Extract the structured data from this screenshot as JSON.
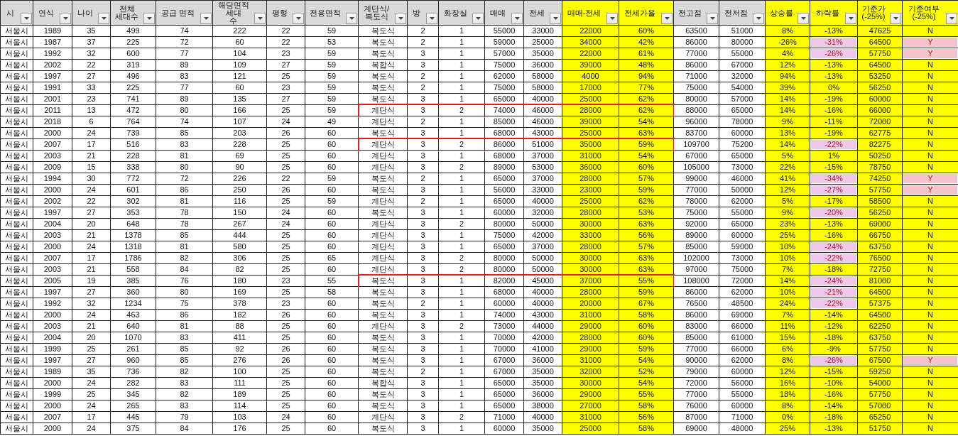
{
  "columns": [
    {
      "label": "시",
      "highlight": false
    },
    {
      "label": "연식",
      "highlight": false
    },
    {
      "label": "나이",
      "highlight": false
    },
    {
      "label": "전체\n세대수",
      "highlight": false
    },
    {
      "label": "공급 면적",
      "highlight": false
    },
    {
      "label": "해당면적 세대\n수",
      "highlight": false
    },
    {
      "label": "평형",
      "highlight": false
    },
    {
      "label": "전용면적",
      "highlight": false
    },
    {
      "label": "계단식/\n복도식",
      "highlight": false
    },
    {
      "label": "방",
      "highlight": false
    },
    {
      "label": "화장실",
      "highlight": false
    },
    {
      "label": "매매",
      "highlight": false
    },
    {
      "label": "전세",
      "highlight": false
    },
    {
      "label": "매매-전세",
      "highlight": true
    },
    {
      "label": "전세가율",
      "highlight": true
    },
    {
      "label": "전고점",
      "highlight": false
    },
    {
      "label": "전저점",
      "highlight": false
    },
    {
      "label": "상승률",
      "highlight": true
    },
    {
      "label": "하락률",
      "highlight": true
    },
    {
      "label": "기준가\n(-25%)",
      "highlight": true
    },
    {
      "label": "기준여부\n(-25%)",
      "highlight": true
    }
  ],
  "rows": [
    {
      "cells": [
        "서울시",
        "1989",
        "35",
        "499",
        "74",
        "222",
        "22",
        "59",
        "복도식",
        "2",
        "1",
        "55000",
        "33000",
        "22000",
        "60%",
        "63500",
        "51000",
        "8%",
        "-13%",
        "47625",
        "N"
      ],
      "fall_alert": false,
      "flag_alert": false,
      "outlined": false
    },
    {
      "cells": [
        "서울시",
        "1987",
        "37",
        "225",
        "72",
        "60",
        "22",
        "53",
        "복도식",
        "2",
        "1",
        "59000",
        "25000",
        "34000",
        "42%",
        "86000",
        "80000",
        "-26%",
        "-31%",
        "64500",
        "Y"
      ],
      "fall_alert": true,
      "flag_alert": true,
      "outlined": false
    },
    {
      "cells": [
        "서울시",
        "1992",
        "32",
        "600",
        "77",
        "104",
        "23",
        "59",
        "복도식",
        "3",
        "1",
        "57000",
        "35000",
        "22000",
        "61%",
        "77000",
        "55000",
        "4%",
        "-26%",
        "57750",
        "Y"
      ],
      "fall_alert": true,
      "flag_alert": true,
      "outlined": false
    },
    {
      "cells": [
        "서울시",
        "2002",
        "22",
        "319",
        "89",
        "109",
        "27",
        "59",
        "복합식",
        "3",
        "1",
        "75000",
        "36000",
        "39000",
        "48%",
        "86000",
        "67000",
        "12%",
        "-13%",
        "64500",
        "N"
      ],
      "fall_alert": false,
      "flag_alert": false,
      "outlined": false
    },
    {
      "cells": [
        "서울시",
        "1997",
        "27",
        "496",
        "83",
        "121",
        "25",
        "59",
        "복도식",
        "2",
        "1",
        "62000",
        "58000",
        "4000",
        "94%",
        "71000",
        "32000",
        "94%",
        "-13%",
        "53250",
        "N"
      ],
      "fall_alert": false,
      "flag_alert": false,
      "outlined": false
    },
    {
      "cells": [
        "서울시",
        "1991",
        "33",
        "225",
        "77",
        "60",
        "23",
        "59",
        "복도식",
        "2",
        "1",
        "75000",
        "58000",
        "17000",
        "77%",
        "75000",
        "54000",
        "39%",
        "0%",
        "56250",
        "N"
      ],
      "fall_alert": false,
      "flag_alert": false,
      "outlined": false
    },
    {
      "cells": [
        "서울시",
        "2001",
        "23",
        "741",
        "89",
        "135",
        "27",
        "59",
        "복도식",
        "3",
        "1",
        "65000",
        "40000",
        "25000",
        "62%",
        "80000",
        "57000",
        "14%",
        "-19%",
        "60000",
        "N"
      ],
      "fall_alert": false,
      "flag_alert": false,
      "outlined": false
    },
    {
      "cells": [
        "서울시",
        "2011",
        "13",
        "472",
        "80",
        "166",
        "25",
        "59",
        "계단식",
        "3",
        "2",
        "74000",
        "46000",
        "28000",
        "62%",
        "88000",
        "65000",
        "14%",
        "-16%",
        "66000",
        "N"
      ],
      "fall_alert": false,
      "flag_alert": false,
      "outlined": true
    },
    {
      "cells": [
        "서울시",
        "2018",
        "6",
        "764",
        "74",
        "107",
        "24",
        "49",
        "계단식",
        "2",
        "1",
        "85000",
        "46000",
        "39000",
        "54%",
        "96000",
        "78000",
        "9%",
        "-11%",
        "72000",
        "N"
      ],
      "fall_alert": false,
      "flag_alert": false,
      "outlined": false
    },
    {
      "cells": [
        "서울시",
        "2000",
        "24",
        "739",
        "85",
        "203",
        "26",
        "60",
        "복도식",
        "3",
        "1",
        "68000",
        "43000",
        "25000",
        "63%",
        "83700",
        "60000",
        "13%",
        "-19%",
        "62775",
        "N"
      ],
      "fall_alert": false,
      "flag_alert": false,
      "outlined": false
    },
    {
      "cells": [
        "서울시",
        "2007",
        "17",
        "516",
        "83",
        "228",
        "25",
        "60",
        "계단식",
        "3",
        "2",
        "86000",
        "51000",
        "35000",
        "59%",
        "109700",
        "75200",
        "14%",
        "-22%",
        "82275",
        "N"
      ],
      "fall_alert": true,
      "flag_alert": false,
      "outlined": true
    },
    {
      "cells": [
        "서울시",
        "2003",
        "21",
        "228",
        "81",
        "69",
        "25",
        "60",
        "계단식",
        "3",
        "1",
        "68000",
        "37000",
        "31000",
        "54%",
        "67000",
        "65000",
        "5%",
        "1%",
        "50250",
        "N"
      ],
      "fall_alert": false,
      "flag_alert": false,
      "outlined": false
    },
    {
      "cells": [
        "서울시",
        "2009",
        "15",
        "338",
        "80",
        "90",
        "25",
        "60",
        "계단식",
        "3",
        "2",
        "89000",
        "53000",
        "36000",
        "60%",
        "105000",
        "73000",
        "22%",
        "-15%",
        "78750",
        "N"
      ],
      "fall_alert": false,
      "flag_alert": false,
      "outlined": false
    },
    {
      "cells": [
        "서울시",
        "1994",
        "30",
        "772",
        "72",
        "226",
        "22",
        "59",
        "복도식",
        "2",
        "1",
        "65000",
        "37000",
        "28000",
        "57%",
        "99000",
        "46000",
        "41%",
        "-34%",
        "74250",
        "Y"
      ],
      "fall_alert": true,
      "flag_alert": true,
      "outlined": false
    },
    {
      "cells": [
        "서울시",
        "2000",
        "24",
        "601",
        "86",
        "250",
        "26",
        "60",
        "복도식",
        "3",
        "1",
        "56000",
        "33000",
        "23000",
        "59%",
        "77000",
        "50000",
        "12%",
        "-27%",
        "57750",
        "Y"
      ],
      "fall_alert": true,
      "flag_alert": true,
      "outlined": false
    },
    {
      "cells": [
        "서울시",
        "2002",
        "22",
        "302",
        "81",
        "116",
        "25",
        "59",
        "계단식",
        "2",
        "1",
        "65000",
        "40000",
        "25000",
        "62%",
        "78000",
        "62000",
        "5%",
        "-17%",
        "58500",
        "N"
      ],
      "fall_alert": false,
      "flag_alert": false,
      "outlined": false
    },
    {
      "cells": [
        "서울시",
        "1997",
        "27",
        "353",
        "78",
        "150",
        "24",
        "60",
        "복도식",
        "3",
        "1",
        "60000",
        "32000",
        "28000",
        "53%",
        "75000",
        "55000",
        "9%",
        "-20%",
        "56250",
        "N"
      ],
      "fall_alert": true,
      "flag_alert": false,
      "outlined": false
    },
    {
      "cells": [
        "서울시",
        "2004",
        "20",
        "648",
        "78",
        "267",
        "24",
        "60",
        "계단식",
        "3",
        "2",
        "80000",
        "50000",
        "30000",
        "63%",
        "92000",
        "65000",
        "23%",
        "-13%",
        "69000",
        "N"
      ],
      "fall_alert": false,
      "flag_alert": false,
      "outlined": false
    },
    {
      "cells": [
        "서울시",
        "2003",
        "21",
        "1378",
        "85",
        "444",
        "25",
        "60",
        "계단식",
        "3",
        "1",
        "75000",
        "42000",
        "33000",
        "56%",
        "89000",
        "60000",
        "25%",
        "-16%",
        "66750",
        "N"
      ],
      "fall_alert": false,
      "flag_alert": false,
      "outlined": false
    },
    {
      "cells": [
        "서울시",
        "2000",
        "24",
        "1318",
        "81",
        "580",
        "25",
        "60",
        "계단식",
        "3",
        "1",
        "65000",
        "37000",
        "28000",
        "57%",
        "85000",
        "59000",
        "10%",
        "-24%",
        "63750",
        "N"
      ],
      "fall_alert": true,
      "flag_alert": false,
      "outlined": false
    },
    {
      "cells": [
        "서울시",
        "2007",
        "17",
        "1786",
        "82",
        "306",
        "25",
        "65",
        "계단식",
        "3",
        "2",
        "80000",
        "50000",
        "30000",
        "63%",
        "102000",
        "73000",
        "10%",
        "-22%",
        "76500",
        "N"
      ],
      "fall_alert": true,
      "flag_alert": false,
      "outlined": false
    },
    {
      "cells": [
        "서울시",
        "2003",
        "21",
        "558",
        "84",
        "82",
        "25",
        "60",
        "계단식",
        "3",
        "2",
        "80000",
        "50000",
        "30000",
        "63%",
        "97000",
        "75000",
        "7%",
        "-18%",
        "72750",
        "N"
      ],
      "fall_alert": false,
      "flag_alert": false,
      "outlined": false
    },
    {
      "cells": [
        "서울시",
        "2005",
        "19",
        "385",
        "76",
        "180",
        "23",
        "55",
        "복도식",
        "3",
        "1",
        "82000",
        "45000",
        "37000",
        "55%",
        "108000",
        "72000",
        "14%",
        "-24%",
        "81000",
        "N"
      ],
      "fall_alert": true,
      "flag_alert": false,
      "outlined": true
    },
    {
      "cells": [
        "서울시",
        "1997",
        "27",
        "360",
        "80",
        "169",
        "25",
        "58",
        "복도식",
        "3",
        "1",
        "68000",
        "40000",
        "28000",
        "59%",
        "86000",
        "62000",
        "10%",
        "-21%",
        "64500",
        "N"
      ],
      "fall_alert": true,
      "flag_alert": false,
      "outlined": false
    },
    {
      "cells": [
        "서울시",
        "1992",
        "32",
        "1234",
        "75",
        "378",
        "23",
        "60",
        "복도식",
        "2",
        "1",
        "60000",
        "40000",
        "20000",
        "67%",
        "76500",
        "48500",
        "24%",
        "-22%",
        "57375",
        "N"
      ],
      "fall_alert": true,
      "flag_alert": false,
      "outlined": false
    },
    {
      "cells": [
        "서울시",
        "2000",
        "24",
        "463",
        "86",
        "182",
        "26",
        "60",
        "복도식",
        "3",
        "1",
        "74000",
        "43000",
        "31000",
        "58%",
        "86000",
        "69000",
        "7%",
        "-14%",
        "64500",
        "N"
      ],
      "fall_alert": false,
      "flag_alert": false,
      "outlined": false
    },
    {
      "cells": [
        "서울시",
        "2003",
        "21",
        "640",
        "81",
        "88",
        "25",
        "60",
        "계단식",
        "3",
        "2",
        "73000",
        "44000",
        "29000",
        "60%",
        "83000",
        "66000",
        "11%",
        "-12%",
        "62250",
        "N"
      ],
      "fall_alert": false,
      "flag_alert": false,
      "outlined": false
    },
    {
      "cells": [
        "서울시",
        "2004",
        "20",
        "1070",
        "83",
        "411",
        "25",
        "60",
        "복도식",
        "3",
        "1",
        "70000",
        "42000",
        "28000",
        "60%",
        "85000",
        "61000",
        "15%",
        "-18%",
        "63750",
        "N"
      ],
      "fall_alert": false,
      "flag_alert": false,
      "outlined": false
    },
    {
      "cells": [
        "서울시",
        "1999",
        "25",
        "261",
        "85",
        "92",
        "26",
        "60",
        "복도식",
        "3",
        "1",
        "70000",
        "41000",
        "29000",
        "59%",
        "77000",
        "66000",
        "6%",
        "-9%",
        "57750",
        "N"
      ],
      "fall_alert": false,
      "flag_alert": false,
      "outlined": false
    },
    {
      "cells": [
        "서울시",
        "1997",
        "27",
        "960",
        "85",
        "276",
        "26",
        "60",
        "복도식",
        "3",
        "1",
        "67000",
        "36000",
        "31000",
        "54%",
        "90000",
        "62000",
        "8%",
        "-26%",
        "67500",
        "Y"
      ],
      "fall_alert": true,
      "flag_alert": true,
      "outlined": false
    },
    {
      "cells": [
        "서울시",
        "1989",
        "35",
        "736",
        "82",
        "100",
        "25",
        "60",
        "복도식",
        "2",
        "1",
        "67000",
        "35000",
        "32000",
        "52%",
        "79000",
        "60000",
        "12%",
        "-15%",
        "59250",
        "N"
      ],
      "fall_alert": false,
      "flag_alert": false,
      "outlined": false
    },
    {
      "cells": [
        "서울시",
        "2000",
        "24",
        "282",
        "83",
        "111",
        "25",
        "60",
        "복합식",
        "3",
        "1",
        "65000",
        "35000",
        "30000",
        "54%",
        "72000",
        "56000",
        "16%",
        "-10%",
        "54000",
        "N"
      ],
      "fall_alert": false,
      "flag_alert": false,
      "outlined": false
    },
    {
      "cells": [
        "서울시",
        "1999",
        "25",
        "345",
        "82",
        "189",
        "25",
        "60",
        "복도식",
        "3",
        "1",
        "65000",
        "36000",
        "29000",
        "55%",
        "77000",
        "55000",
        "18%",
        "-16%",
        "57750",
        "N"
      ],
      "fall_alert": false,
      "flag_alert": false,
      "outlined": false
    },
    {
      "cells": [
        "서울시",
        "2000",
        "24",
        "265",
        "83",
        "114",
        "25",
        "60",
        "복도식",
        "3",
        "1",
        "65000",
        "38000",
        "27000",
        "58%",
        "76000",
        "60000",
        "8%",
        "-14%",
        "57000",
        "N"
      ],
      "fall_alert": false,
      "flag_alert": false,
      "outlined": false
    },
    {
      "cells": [
        "서울시",
        "2007",
        "17",
        "445",
        "79",
        "103",
        "24",
        "60",
        "계단식",
        "3",
        "2",
        "71000",
        "40000",
        "31000",
        "56%",
        "87000",
        "71000",
        "0%",
        "-18%",
        "65250",
        "N"
      ],
      "fall_alert": false,
      "flag_alert": false,
      "outlined": false
    },
    {
      "cells": [
        "서울시",
        "2000",
        "24",
        "375",
        "84",
        "176",
        "25",
        "60",
        "복도식",
        "3",
        "1",
        "60000",
        "35000",
        "25000",
        "58%",
        "69000",
        "48000",
        "25%",
        "-13%",
        "51750",
        "N"
      ],
      "fall_alert": false,
      "flag_alert": false,
      "outlined": false
    }
  ]
}
